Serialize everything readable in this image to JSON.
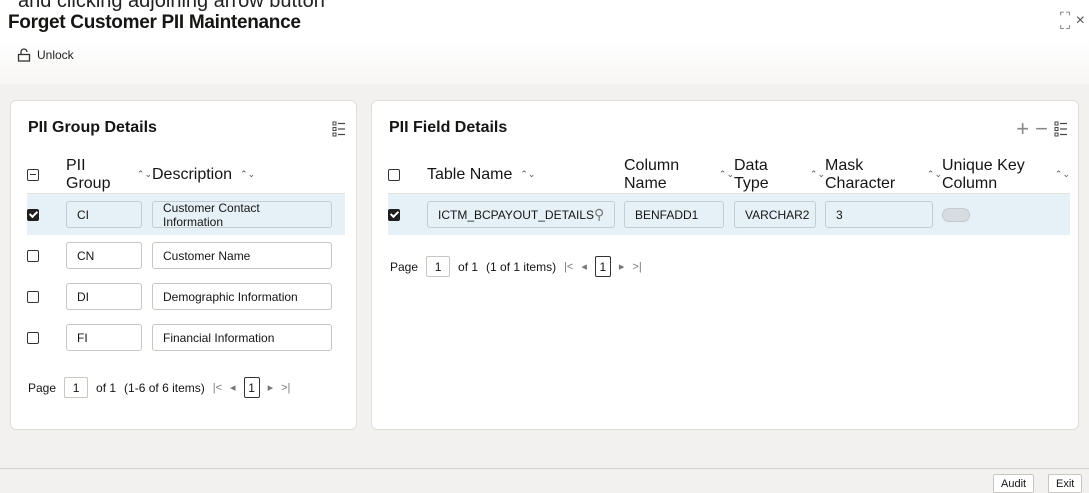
{
  "topcut_text": "and clicking adjoining arrow button",
  "window": {
    "title": "Forget Customer PII Maintenance",
    "close_glyph": "×"
  },
  "toolbar": {
    "unlock_label": "Unlock",
    "icon": "unlock-icon"
  },
  "group_panel": {
    "title": "PII Group Details",
    "columns": [
      "PII Group",
      "Description"
    ],
    "rows": [
      {
        "group": "CI",
        "description": "Customer Contact Information",
        "checked": true
      },
      {
        "group": "CN",
        "description": "Customer Name",
        "checked": false
      },
      {
        "group": "DI",
        "description": "Demographic Information",
        "checked": false
      },
      {
        "group": "FI",
        "description": "Financial Information",
        "checked": false
      }
    ],
    "pager": {
      "label": "Page",
      "page": "1",
      "of": "of 1",
      "items": "(1-6 of 6 items)",
      "current": "1"
    }
  },
  "field_panel": {
    "title": "PII Field Details",
    "columns": [
      "Table Name",
      "Column Name",
      "Data Type",
      "Mask Character",
      "Unique Key Column"
    ],
    "rows": [
      {
        "table": "ICTM_BCPAYOUT_DETAILS",
        "column": "BENFADD1",
        "type": "VARCHAR2",
        "mask": "3",
        "checked": true,
        "unique": false
      }
    ],
    "pager": {
      "label": "Page",
      "page": "1",
      "of": "of 1",
      "items": "(1 of 1 items)",
      "current": "1"
    }
  },
  "footer": {
    "audit_label": "Audit",
    "exit_label": "Exit"
  }
}
